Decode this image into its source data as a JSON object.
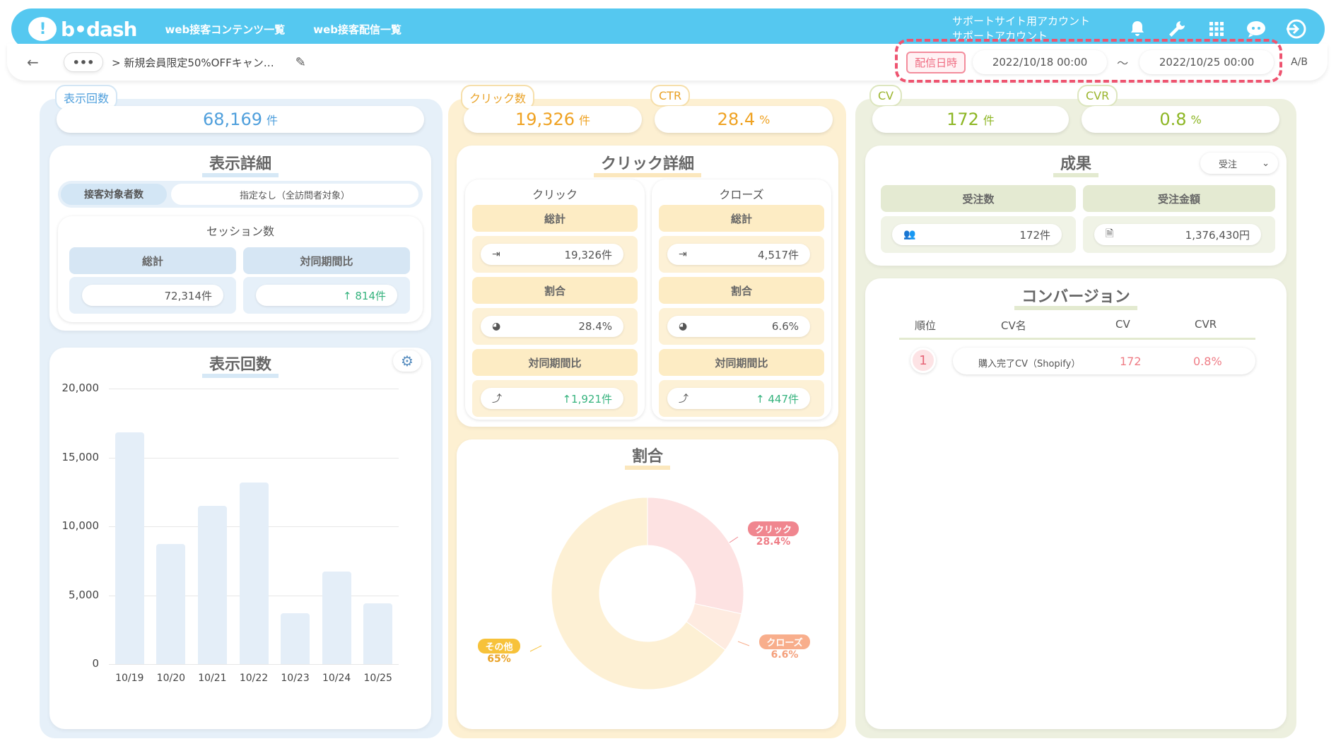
{
  "nav": {
    "logo_text": "b•dash",
    "link1": "web接客コンテンツ一覧",
    "link2": "web接客配信一覧",
    "account_line1": "サポートサイト用アカウント",
    "account_line2": "サポートアカウント"
  },
  "subbar": {
    "dots": "•••",
    "breadcrumb": "> 新規会員限定50%OFFキャン…",
    "date_label": "配信日時",
    "date_from": "2022/10/18 00:00",
    "tilde": "〜",
    "date_to": "2022/10/25 00:00",
    "ab": "A/B"
  },
  "kpis": {
    "impressions_label": "表示回数",
    "impressions_value": "68,169",
    "clicks_label": "クリック数",
    "clicks_value": "19,326",
    "ctr_label": "CTR",
    "ctr_value": "28.4",
    "cv_label": "CV",
    "cv_value": "172",
    "cvr_label": "CVR",
    "cvr_value": "0.8",
    "unit_ken": "件",
    "unit_pct": "%"
  },
  "display_detail": {
    "title": "表示詳細",
    "target_label": "接客対象者数",
    "target_value": "指定なし（全訪問者対象）",
    "session_title": "セッション数",
    "total_label": "総計",
    "yoy_label": "対同期間比",
    "total_value": "72,314件",
    "yoy_value": "↑ 814件"
  },
  "bar_section": {
    "title": "表示回数"
  },
  "chart_data": {
    "type": "bar",
    "categories": [
      "10/19",
      "10/20",
      "10/21",
      "10/22",
      "10/23",
      "10/24",
      "10/25"
    ],
    "values": [
      16800,
      8700,
      11500,
      13200,
      3700,
      6700,
      4400
    ],
    "ylim": [
      0,
      20000
    ],
    "yticks": [
      "20,000",
      "15,000",
      "10,000",
      "5,000",
      "0"
    ],
    "ytick_values": [
      20000,
      15000,
      10000,
      5000,
      0
    ]
  },
  "click_detail": {
    "title": "クリック詳細",
    "click": {
      "title": "クリック",
      "total_label": "総計",
      "total_value": "19,326件",
      "ratio_label": "割合",
      "ratio_value": "28.4%",
      "yoy_label": "対同期間比",
      "yoy_value": "↑1,921件"
    },
    "close": {
      "title": "クローズ",
      "total_label": "総計",
      "total_value": "4,517件",
      "ratio_label": "割合",
      "ratio_value": "6.6%",
      "yoy_label": "対同期間比",
      "yoy_value": "↑ 447件"
    }
  },
  "ratio_section": {
    "title": "割合",
    "slices": [
      {
        "name": "クリック",
        "value": 28.4,
        "label": "28.4%",
        "color": "#fde2e2",
        "tag_color": "#f0868f",
        "text_color": "#ef7d86"
      },
      {
        "name": "クローズ",
        "value": 6.6,
        "label": "6.6%",
        "color": "#feebe0",
        "tag_color": "#f8ae8c",
        "text_color": "#f4a07c"
      },
      {
        "name": "その他",
        "value": 65,
        "label": "65%",
        "color": "#fdf0d4",
        "tag_color": "#f7c23a",
        "text_color": "#e9a227"
      }
    ]
  },
  "results": {
    "title": "成果",
    "select_value": "受注",
    "orders_label": "受注数",
    "amount_label": "受注金額",
    "orders_value": "172件",
    "amount_value": "1,376,430円"
  },
  "conversion": {
    "title": "コンバージョン",
    "headers": [
      "順位",
      "CV名",
      "CV",
      "CVR"
    ],
    "rows": [
      {
        "rank": "1",
        "name": "購入完了CV（Shopify）",
        "cv": "172",
        "cvr": "0.8%"
      }
    ]
  }
}
